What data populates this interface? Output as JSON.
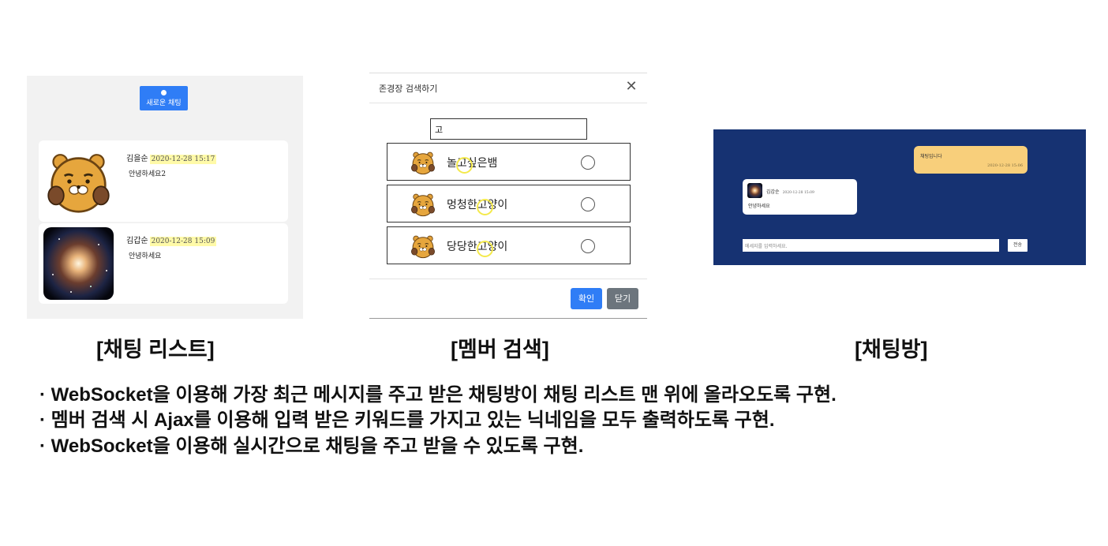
{
  "chat_list": {
    "new_chat_label": "새로운 채팅",
    "items": [
      {
        "name": "김을순",
        "time": "2020-12-28 15:17",
        "message": "안녕하세요2",
        "avatar": "ryan-character-icon"
      },
      {
        "name": "김갑순",
        "time": "2020-12-28 15:09",
        "message": "안녕하세요",
        "avatar": "galaxy-photo"
      }
    ]
  },
  "member_search": {
    "title": "존경장 검색하기",
    "search_value": "고",
    "results": [
      {
        "pre": "놀",
        "hl": "고",
        "post": "싶은뱀"
      },
      {
        "pre": "멍청한",
        "hl": "고",
        "post": "양이"
      },
      {
        "pre": "당당한",
        "hl": "고",
        "post": "양이"
      }
    ],
    "ok_label": "확인",
    "close_label": "닫기"
  },
  "chat_room": {
    "my_message": "채팅입니다",
    "my_time": "2020-12-28 15:06",
    "other_name": "김갑순",
    "other_time": "2020-12-28 15:09",
    "other_message": "안녕하세요",
    "input_placeholder": "메세지를 입력하세요.",
    "send_label": "전송",
    "background_color": "#163272"
  },
  "captions": {
    "chat_list": "[채팅 리스트]",
    "member_search": "[멤버 검색]",
    "chat_room": "[채팅방]"
  },
  "bullets": [
    "· WebSocket을 이용해 가장 최근 메시지를 주고 받은 채팅방이 채팅 리스트 맨 위에 올라오도록 구현.",
    "· 멤버 검색 시 Ajax를 이용해 입력 받은 키워드를 가지고 있는 닉네임을 모두 출력하도록 구현.",
    "· WebSocket을 이용해 실시간으로 채팅을 주고 받을 수 있도록 구현."
  ]
}
